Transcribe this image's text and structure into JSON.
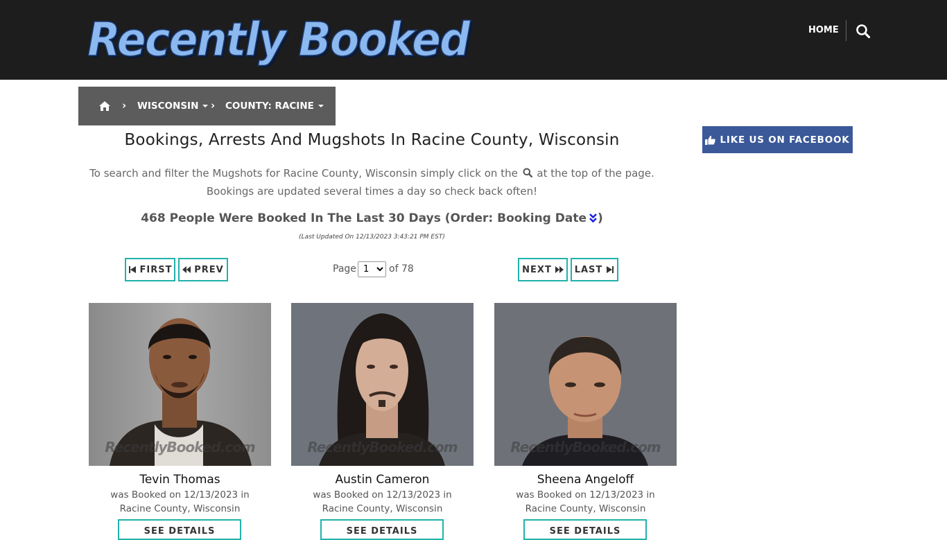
{
  "header": {
    "logo_text": "Recently Booked",
    "nav_home": "HOME",
    "search_icon": "search-icon"
  },
  "breadcrumb": {
    "home_icon": "home-icon",
    "items": [
      {
        "label": "WISCONSIN"
      },
      {
        "label": "COUNTY: RACINE"
      }
    ]
  },
  "main": {
    "headline": "Bookings, Arrests And Mugshots In Racine County, Wisconsin",
    "intro_part1": "To search and filter the Mugshots for Racine County, Wisconsin simply click on the",
    "intro_part2": "at the top of the page.",
    "intro_line2": "Bookings are updated several times a day so check back often!",
    "count_text": "468 People Were Booked In The Last 30 Days (Order: Booking Date",
    "count_close": ")",
    "last_updated": "(Last Updated On 12/13/2023 3:43:21 PM EST)"
  },
  "pagination": {
    "first": "FIRST",
    "prev": "PREV",
    "next": "NEXT",
    "last": "LAST",
    "page_label": "Page",
    "current_page": "1",
    "of_label": "of 78"
  },
  "cards": [
    {
      "name": "Tevin Thomas",
      "line1": "was Booked on 12/13/2023 in",
      "line2": "Racine County, Wisconsin",
      "button": "SEE DETAILS",
      "watermark": "RecentlyBooked.com"
    },
    {
      "name": "Austin Cameron",
      "line1": "was Booked on 12/13/2023 in",
      "line2": "Racine County, Wisconsin",
      "button": "SEE DETAILS",
      "watermark": "RecentlyBooked.com"
    },
    {
      "name": "Sheena Angeloff",
      "line1": "was Booked on 12/13/2023 in",
      "line2": "Racine County, Wisconsin",
      "button": "SEE DETAILS",
      "watermark": "RecentlyBooked.com"
    }
  ],
  "sidebar": {
    "facebook_label": "LIKE US ON FACEBOOK",
    "facebook_icon": "thumbs-up-icon"
  },
  "colors": {
    "header_bg": "#1d1d1d",
    "breadcrumb_bg": "#5c5c5c",
    "button_border": "#20b2aa",
    "facebook_bg": "#3b5998"
  }
}
